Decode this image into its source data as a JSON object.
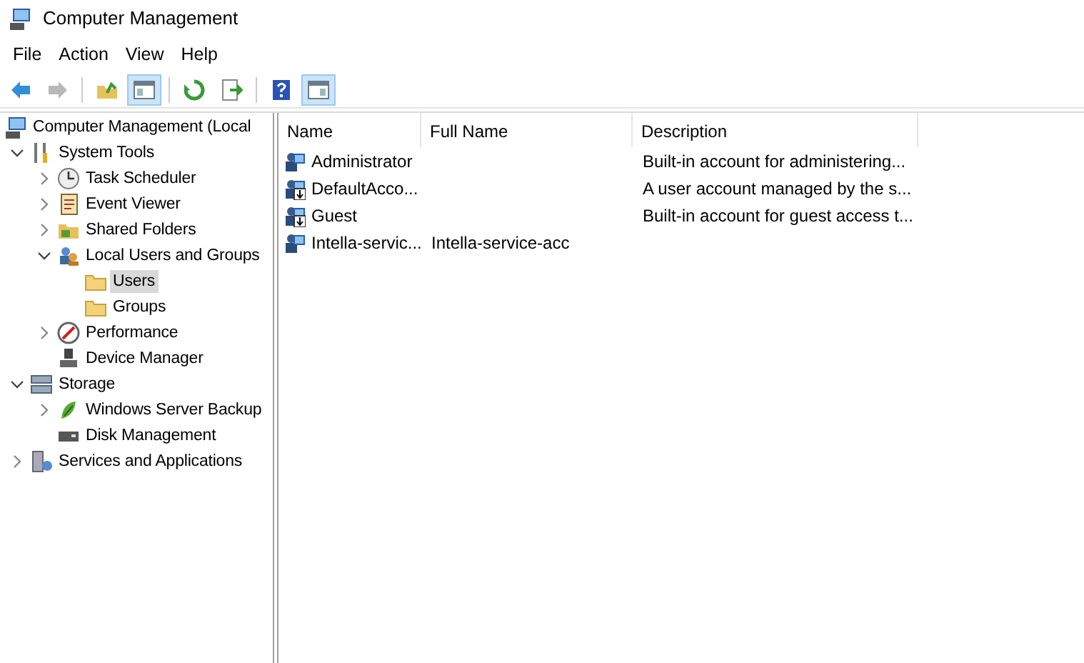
{
  "window": {
    "title": "Computer Management"
  },
  "menu": [
    "File",
    "Action",
    "View",
    "Help"
  ],
  "toolbar": [
    [
      {
        "pressed": false,
        "disabled": false
      },
      {
        "pressed": false,
        "disabled": true
      }
    ],
    [
      {
        "pressed": false,
        "disabled": false
      },
      {
        "pressed": true,
        "disabled": false
      }
    ],
    [
      {
        "pressed": false,
        "disabled": false
      },
      {
        "pressed": false,
        "disabled": false
      }
    ],
    [
      {
        "pressed": false,
        "disabled": false
      },
      {
        "pressed": true,
        "disabled": false
      }
    ]
  ],
  "tree": [
    {
      "label": "Computer Management (Local",
      "selected": false,
      "children": [
        {
          "label": "System Tools",
          "expanded": true,
          "selected": false,
          "children": [
            {
              "label": "Task Scheduler",
              "expanded": false,
              "selected": false
            },
            {
              "label": "Event Viewer",
              "expanded": false,
              "selected": false
            },
            {
              "label": "Shared Folders",
              "expanded": false,
              "selected": false
            },
            {
              "label": "Local Users and Groups",
              "expanded": true,
              "selected": false,
              "children": [
                {
                  "label": "Users",
                  "selected": true
                },
                {
                  "label": "Groups",
                  "selected": false
                }
              ]
            },
            {
              "label": "Performance",
              "expanded": false,
              "selected": false
            },
            {
              "label": "Device Manager",
              "selected": false
            }
          ]
        },
        {
          "label": "Storage",
          "expanded": true,
          "selected": false,
          "children": [
            {
              "label": "Windows Server Backup",
              "expanded": false,
              "selected": false
            },
            {
              "label": "Disk Management",
              "selected": false
            }
          ]
        },
        {
          "label": "Services and Applications",
          "expanded": false,
          "selected": false
        }
      ]
    }
  ],
  "table": {
    "columns": [
      "Name",
      "Full Name",
      "Description"
    ],
    "rows": [
      {
        "name": "Administrator",
        "full_name": "",
        "description": "Built-in account for administering...",
        "disabled": false
      },
      {
        "name": "DefaultAcco...",
        "full_name": "",
        "description": "A user account managed by the s...",
        "disabled": true
      },
      {
        "name": "Guest",
        "full_name": "",
        "description": "Built-in account for guest access t...",
        "disabled": true
      },
      {
        "name": "Intella-servic...",
        "full_name": "Intella-service-acc",
        "description": "",
        "disabled": false
      }
    ]
  }
}
